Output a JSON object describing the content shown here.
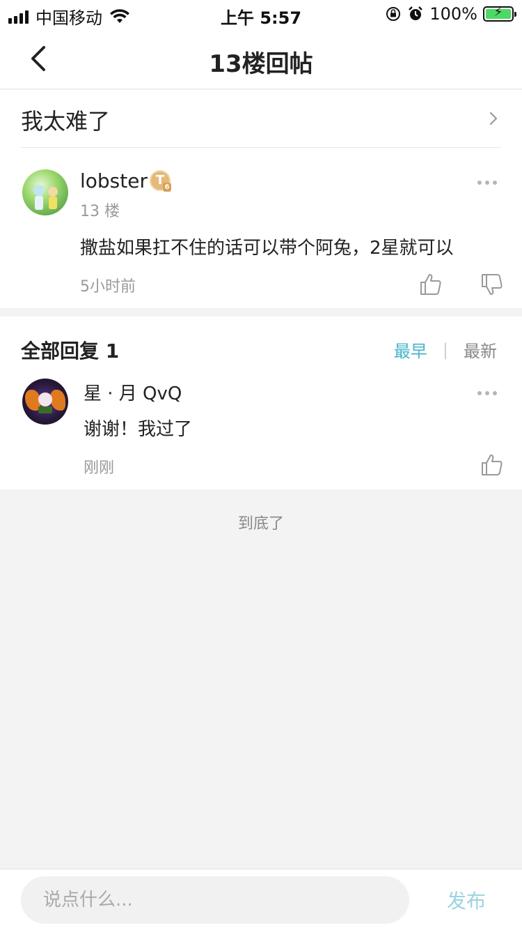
{
  "status_bar": {
    "carrier": "中国移动",
    "time": "上午 5:57",
    "battery": "100%"
  },
  "nav": {
    "title": "13楼回帖"
  },
  "thread": {
    "title": "我太难了"
  },
  "post": {
    "author": "lobster",
    "level_badge": "T",
    "level_number": "6",
    "floor": "13 楼",
    "content": "撒盐如果扛不住的话可以带个阿兔，2星就可以",
    "time": "5小时前"
  },
  "replies": {
    "header": "全部回复 1",
    "sort_earliest": "最早",
    "sort_separator": "|",
    "sort_latest": "最新",
    "items": [
      {
        "author": "星 · 月 QvQ",
        "content": "谢谢！我过了",
        "time": "刚刚"
      }
    ]
  },
  "footer": {
    "end_text": "到底了"
  },
  "comment_bar": {
    "placeholder": "说点什么...",
    "publish_label": "发布"
  },
  "colors": {
    "accent": "#45b5c9",
    "publish_disabled": "#9cd3df",
    "battery": "#4cd964"
  },
  "icons": {
    "back": "chevron-left-icon",
    "arrow": "chevron-right-icon",
    "more": "more-horizontal-icon",
    "like": "thumbs-up-icon",
    "dislike": "thumbs-down-icon",
    "wifi": "wifi-icon",
    "lock": "orientation-lock-icon",
    "alarm": "alarm-icon"
  }
}
